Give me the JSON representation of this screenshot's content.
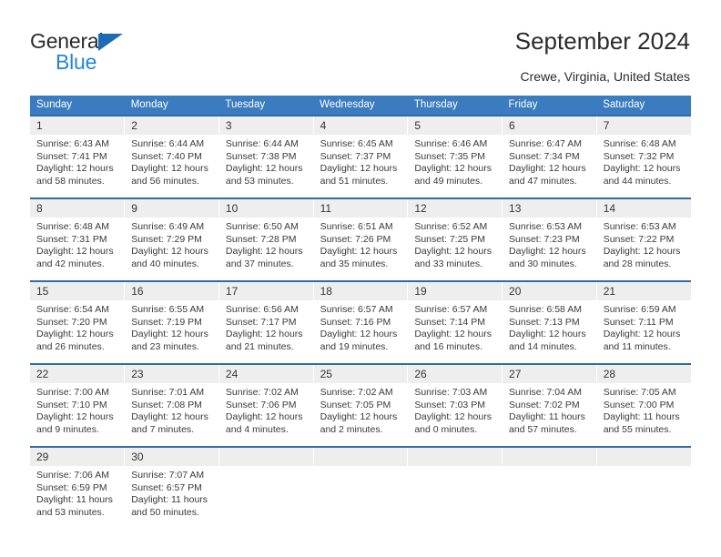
{
  "brand": {
    "name_part1": "General",
    "name_part2": "Blue",
    "triangle_color": "#1b6cb5",
    "blue_text_color": "#2485d4"
  },
  "header": {
    "title": "September 2024",
    "location": "Crewe, Virginia, United States"
  },
  "theme": {
    "header_row_bg": "#3b7cc0",
    "header_row_text": "#ffffff",
    "row_top_border": "#2f6ca8",
    "daynum_bg": "#eeeeee",
    "body_text": "#3a3a3a"
  },
  "weekdays": [
    "Sunday",
    "Monday",
    "Tuesday",
    "Wednesday",
    "Thursday",
    "Friday",
    "Saturday"
  ],
  "labels": {
    "sunrise": "Sunrise:",
    "sunset": "Sunset:",
    "daylight": "Daylight:"
  },
  "weeks": [
    [
      {
        "day": "1",
        "sunrise": "Sunrise: 6:43 AM",
        "sunset": "Sunset: 7:41 PM",
        "daylight_line1": "Daylight: 12 hours",
        "daylight_line2": "and 58 minutes."
      },
      {
        "day": "2",
        "sunrise": "Sunrise: 6:44 AM",
        "sunset": "Sunset: 7:40 PM",
        "daylight_line1": "Daylight: 12 hours",
        "daylight_line2": "and 56 minutes."
      },
      {
        "day": "3",
        "sunrise": "Sunrise: 6:44 AM",
        "sunset": "Sunset: 7:38 PM",
        "daylight_line1": "Daylight: 12 hours",
        "daylight_line2": "and 53 minutes."
      },
      {
        "day": "4",
        "sunrise": "Sunrise: 6:45 AM",
        "sunset": "Sunset: 7:37 PM",
        "daylight_line1": "Daylight: 12 hours",
        "daylight_line2": "and 51 minutes."
      },
      {
        "day": "5",
        "sunrise": "Sunrise: 6:46 AM",
        "sunset": "Sunset: 7:35 PM",
        "daylight_line1": "Daylight: 12 hours",
        "daylight_line2": "and 49 minutes."
      },
      {
        "day": "6",
        "sunrise": "Sunrise: 6:47 AM",
        "sunset": "Sunset: 7:34 PM",
        "daylight_line1": "Daylight: 12 hours",
        "daylight_line2": "and 47 minutes."
      },
      {
        "day": "7",
        "sunrise": "Sunrise: 6:48 AM",
        "sunset": "Sunset: 7:32 PM",
        "daylight_line1": "Daylight: 12 hours",
        "daylight_line2": "and 44 minutes."
      }
    ],
    [
      {
        "day": "8",
        "sunrise": "Sunrise: 6:48 AM",
        "sunset": "Sunset: 7:31 PM",
        "daylight_line1": "Daylight: 12 hours",
        "daylight_line2": "and 42 minutes."
      },
      {
        "day": "9",
        "sunrise": "Sunrise: 6:49 AM",
        "sunset": "Sunset: 7:29 PM",
        "daylight_line1": "Daylight: 12 hours",
        "daylight_line2": "and 40 minutes."
      },
      {
        "day": "10",
        "sunrise": "Sunrise: 6:50 AM",
        "sunset": "Sunset: 7:28 PM",
        "daylight_line1": "Daylight: 12 hours",
        "daylight_line2": "and 37 minutes."
      },
      {
        "day": "11",
        "sunrise": "Sunrise: 6:51 AM",
        "sunset": "Sunset: 7:26 PM",
        "daylight_line1": "Daylight: 12 hours",
        "daylight_line2": "and 35 minutes."
      },
      {
        "day": "12",
        "sunrise": "Sunrise: 6:52 AM",
        "sunset": "Sunset: 7:25 PM",
        "daylight_line1": "Daylight: 12 hours",
        "daylight_line2": "and 33 minutes."
      },
      {
        "day": "13",
        "sunrise": "Sunrise: 6:53 AM",
        "sunset": "Sunset: 7:23 PM",
        "daylight_line1": "Daylight: 12 hours",
        "daylight_line2": "and 30 minutes."
      },
      {
        "day": "14",
        "sunrise": "Sunrise: 6:53 AM",
        "sunset": "Sunset: 7:22 PM",
        "daylight_line1": "Daylight: 12 hours",
        "daylight_line2": "and 28 minutes."
      }
    ],
    [
      {
        "day": "15",
        "sunrise": "Sunrise: 6:54 AM",
        "sunset": "Sunset: 7:20 PM",
        "daylight_line1": "Daylight: 12 hours",
        "daylight_line2": "and 26 minutes."
      },
      {
        "day": "16",
        "sunrise": "Sunrise: 6:55 AM",
        "sunset": "Sunset: 7:19 PM",
        "daylight_line1": "Daylight: 12 hours",
        "daylight_line2": "and 23 minutes."
      },
      {
        "day": "17",
        "sunrise": "Sunrise: 6:56 AM",
        "sunset": "Sunset: 7:17 PM",
        "daylight_line1": "Daylight: 12 hours",
        "daylight_line2": "and 21 minutes."
      },
      {
        "day": "18",
        "sunrise": "Sunrise: 6:57 AM",
        "sunset": "Sunset: 7:16 PM",
        "daylight_line1": "Daylight: 12 hours",
        "daylight_line2": "and 19 minutes."
      },
      {
        "day": "19",
        "sunrise": "Sunrise: 6:57 AM",
        "sunset": "Sunset: 7:14 PM",
        "daylight_line1": "Daylight: 12 hours",
        "daylight_line2": "and 16 minutes."
      },
      {
        "day": "20",
        "sunrise": "Sunrise: 6:58 AM",
        "sunset": "Sunset: 7:13 PM",
        "daylight_line1": "Daylight: 12 hours",
        "daylight_line2": "and 14 minutes."
      },
      {
        "day": "21",
        "sunrise": "Sunrise: 6:59 AM",
        "sunset": "Sunset: 7:11 PM",
        "daylight_line1": "Daylight: 12 hours",
        "daylight_line2": "and 11 minutes."
      }
    ],
    [
      {
        "day": "22",
        "sunrise": "Sunrise: 7:00 AM",
        "sunset": "Sunset: 7:10 PM",
        "daylight_line1": "Daylight: 12 hours",
        "daylight_line2": "and 9 minutes."
      },
      {
        "day": "23",
        "sunrise": "Sunrise: 7:01 AM",
        "sunset": "Sunset: 7:08 PM",
        "daylight_line1": "Daylight: 12 hours",
        "daylight_line2": "and 7 minutes."
      },
      {
        "day": "24",
        "sunrise": "Sunrise: 7:02 AM",
        "sunset": "Sunset: 7:06 PM",
        "daylight_line1": "Daylight: 12 hours",
        "daylight_line2": "and 4 minutes."
      },
      {
        "day": "25",
        "sunrise": "Sunrise: 7:02 AM",
        "sunset": "Sunset: 7:05 PM",
        "daylight_line1": "Daylight: 12 hours",
        "daylight_line2": "and 2 minutes."
      },
      {
        "day": "26",
        "sunrise": "Sunrise: 7:03 AM",
        "sunset": "Sunset: 7:03 PM",
        "daylight_line1": "Daylight: 12 hours",
        "daylight_line2": "and 0 minutes."
      },
      {
        "day": "27",
        "sunrise": "Sunrise: 7:04 AM",
        "sunset": "Sunset: 7:02 PM",
        "daylight_line1": "Daylight: 11 hours",
        "daylight_line2": "and 57 minutes."
      },
      {
        "day": "28",
        "sunrise": "Sunrise: 7:05 AM",
        "sunset": "Sunset: 7:00 PM",
        "daylight_line1": "Daylight: 11 hours",
        "daylight_line2": "and 55 minutes."
      }
    ],
    [
      {
        "day": "29",
        "sunrise": "Sunrise: 7:06 AM",
        "sunset": "Sunset: 6:59 PM",
        "daylight_line1": "Daylight: 11 hours",
        "daylight_line2": "and 53 minutes."
      },
      {
        "day": "30",
        "sunrise": "Sunrise: 7:07 AM",
        "sunset": "Sunset: 6:57 PM",
        "daylight_line1": "Daylight: 11 hours",
        "daylight_line2": "and 50 minutes."
      },
      {
        "day": "",
        "sunrise": "",
        "sunset": "",
        "daylight_line1": "",
        "daylight_line2": ""
      },
      {
        "day": "",
        "sunrise": "",
        "sunset": "",
        "daylight_line1": "",
        "daylight_line2": ""
      },
      {
        "day": "",
        "sunrise": "",
        "sunset": "",
        "daylight_line1": "",
        "daylight_line2": ""
      },
      {
        "day": "",
        "sunrise": "",
        "sunset": "",
        "daylight_line1": "",
        "daylight_line2": ""
      },
      {
        "day": "",
        "sunrise": "",
        "sunset": "",
        "daylight_line1": "",
        "daylight_line2": ""
      }
    ]
  ]
}
